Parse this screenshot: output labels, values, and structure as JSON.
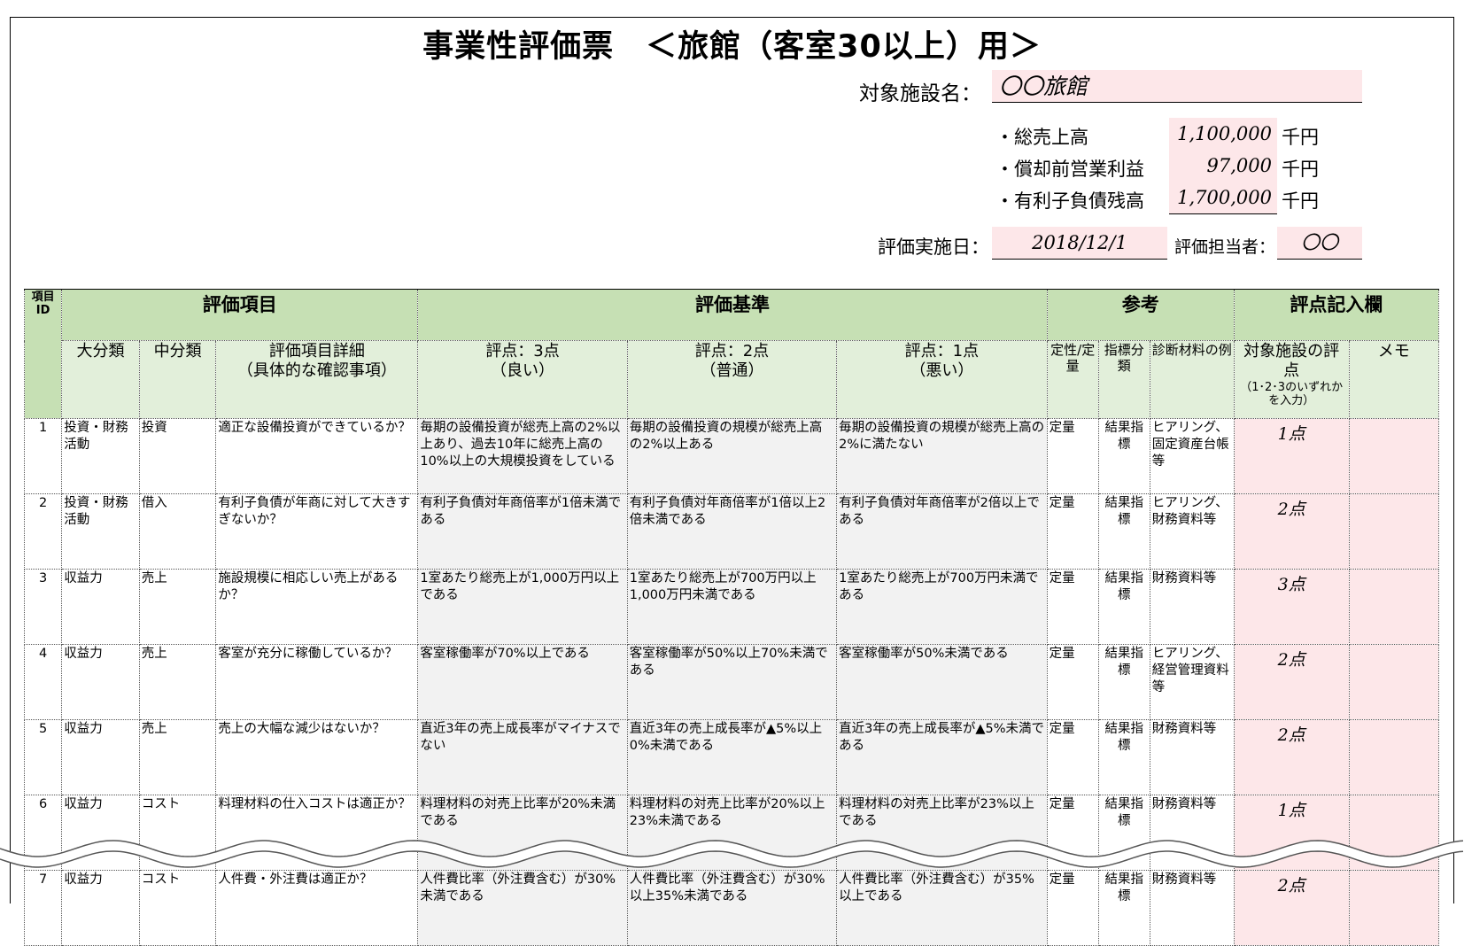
{
  "title": "事業性評価票　＜旅館（客室30以上）用＞",
  "facility": {
    "label": "対象施設名：",
    "value": "〇〇旅館"
  },
  "financials": [
    {
      "label": "・総売上高",
      "value": "1,100,000",
      "unit": "千円"
    },
    {
      "label": "・償却前営業利益",
      "value": "97,000",
      "unit": "千円"
    },
    {
      "label": "・有利子負債残高",
      "value": "1,700,000",
      "unit": "千円"
    }
  ],
  "eval_date": {
    "label": "評価実施日：",
    "value": "2018/12/1"
  },
  "evaluator": {
    "label": "評価担当者：",
    "value": "〇〇"
  },
  "table": {
    "group_headers": {
      "id": "項目 ID",
      "items": "評価項目",
      "criteria": "評価基準",
      "reference": "参考",
      "score_entry": "評点記入欄"
    },
    "sub_headers": {
      "major": "大分類",
      "middle": "中分類",
      "detail": "評価項目詳細",
      "detail_sub": "（具体的な確認事項）",
      "s3": "評点：3点",
      "s3_sub": "（良い）",
      "s2": "評点：2点",
      "s2_sub": "（普通）",
      "s1": "評点：1点",
      "s1_sub": "（悪い）",
      "qual": "定性/定量",
      "indicator": "指標分類",
      "material": "診断材料の例",
      "facility_score": "対象施設の評点",
      "facility_score_note": "（1･2･3のいずれかを入力）",
      "memo": "メモ"
    },
    "rows": [
      {
        "id": "1",
        "major": "投資・財務活動",
        "middle": "投資",
        "detail": "適正な設備投資ができているか？",
        "s3": "毎期の設備投資が総売上高の2%以上あり、過去10年に総売上高の10%以上の大規模投資をしている",
        "s2": "毎期の設備投資の規模が総売上高の2%以上ある",
        "s1": "毎期の設備投資の規模が総売上高の2%に満たない",
        "qual": "定量",
        "indicator": "結果指標",
        "material": "ヒアリング、固定資産台帳等",
        "score": "1点",
        "memo": ""
      },
      {
        "id": "2",
        "major": "投資・財務活動",
        "middle": "借入",
        "detail": "有利子負債が年商に対して大きすぎないか？",
        "s3": "有利子負債対年商倍率が1倍未満である",
        "s2": "有利子負債対年商倍率が1倍以上2倍未満である",
        "s1": "有利子負債対年商倍率が2倍以上である",
        "qual": "定量",
        "indicator": "結果指標",
        "material": "ヒアリング、財務資料等",
        "score": "2点",
        "memo": ""
      },
      {
        "id": "3",
        "major": "収益力",
        "middle": "売上",
        "detail": "施設規模に相応しい売上があるか？",
        "s3": "1室あたり総売上が1,000万円以上である",
        "s2": "1室あたり総売上が700万円以上1,000万円未満である",
        "s1": "1室あたり総売上が700万円未満である",
        "qual": "定量",
        "indicator": "結果指標",
        "material": "財務資料等",
        "score": "3点",
        "memo": ""
      },
      {
        "id": "4",
        "major": "収益力",
        "middle": "売上",
        "detail": "客室が充分に稼働しているか？",
        "s3": "客室稼働率が70%以上である",
        "s2": "客室稼働率が50%以上70%未満である",
        "s1": "客室稼働率が50%未満である",
        "qual": "定量",
        "indicator": "結果指標",
        "material": "ヒアリング、経営管理資料等",
        "score": "2点",
        "memo": ""
      },
      {
        "id": "5",
        "major": "収益力",
        "middle": "売上",
        "detail": "売上の大幅な減少はないか？",
        "s3": "直近3年の売上成長率がマイナスでない",
        "s2": "直近3年の売上成長率が▲5%以上0%未満である",
        "s1": "直近3年の売上成長率が▲5%未満である",
        "qual": "定量",
        "indicator": "結果指標",
        "material": "財務資料等",
        "score": "2点",
        "memo": ""
      },
      {
        "id": "6",
        "major": "収益力",
        "middle": "コスト",
        "detail": "料理材料の仕入コストは適正か？",
        "s3": "料理材料の対売上比率が20%未満である",
        "s2": "料理材料の対売上比率が20%以上23%未満である",
        "s1": "料理材料の対売上比率が23%以上である",
        "qual": "定量",
        "indicator": "結果指標",
        "material": "財務資料等",
        "score": "1点",
        "memo": ""
      },
      {
        "id": "7",
        "major": "収益力",
        "middle": "コスト",
        "detail": "人件費・外注費は適正か？",
        "s3": "人件費比率（外注費含む）が30%未満である",
        "s2": "人件費比率（外注費含む）が30%以上35%未満である",
        "s1": "人件費比率（外注費含む）が35%以上である",
        "qual": "定量",
        "indicator": "結果指標",
        "material": "財務資料等",
        "score": "2点",
        "memo": ""
      }
    ]
  }
}
